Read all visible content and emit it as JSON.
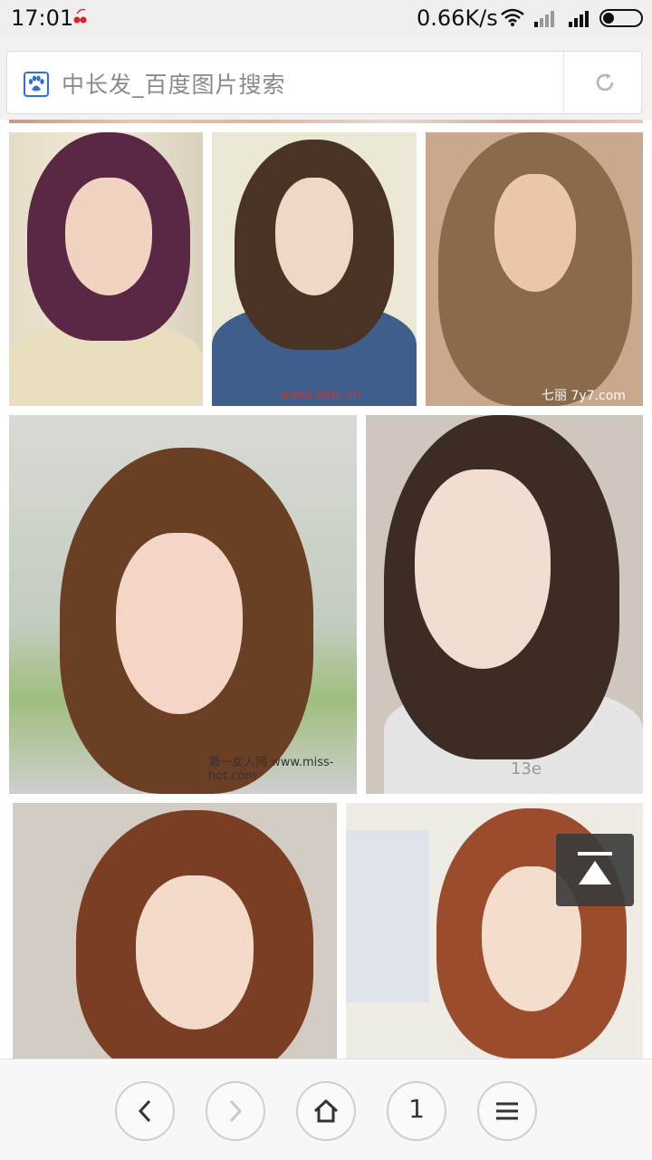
{
  "status_bar": {
    "time": "17:01",
    "net_speed": "0.66K/s",
    "icons": [
      "cherry-icon",
      "wifi-icon",
      "signal-icon",
      "signal-icon",
      "battery-icon"
    ]
  },
  "browser": {
    "page_title": "中长发_百度图片搜索",
    "site_icon": "baidu-paw-icon",
    "refresh_icon": "refresh-icon"
  },
  "image_tiles": [
    {
      "watermark": ""
    },
    {
      "watermark": "www.babi.cn"
    },
    {
      "watermark": "七丽 7y7.com"
    },
    {
      "watermark": "第一女人网 www.miss-hot.com"
    },
    {
      "watermark": "13e"
    },
    {
      "watermark": ""
    },
    {
      "watermark": ""
    }
  ],
  "scroll_top_icon": "scroll-to-top-icon",
  "bottom_nav": {
    "back_icon": "back-arrow-icon",
    "forward_icon": "forward-arrow-icon",
    "home_icon": "home-icon",
    "tab_count": "1",
    "menu_icon": "menu-icon"
  },
  "colors": {
    "status_bg": "#efefef",
    "nav_bg": "#f7f7f7",
    "paw_blue": "#2f6fd6",
    "title_gray": "#8a8a8a"
  }
}
